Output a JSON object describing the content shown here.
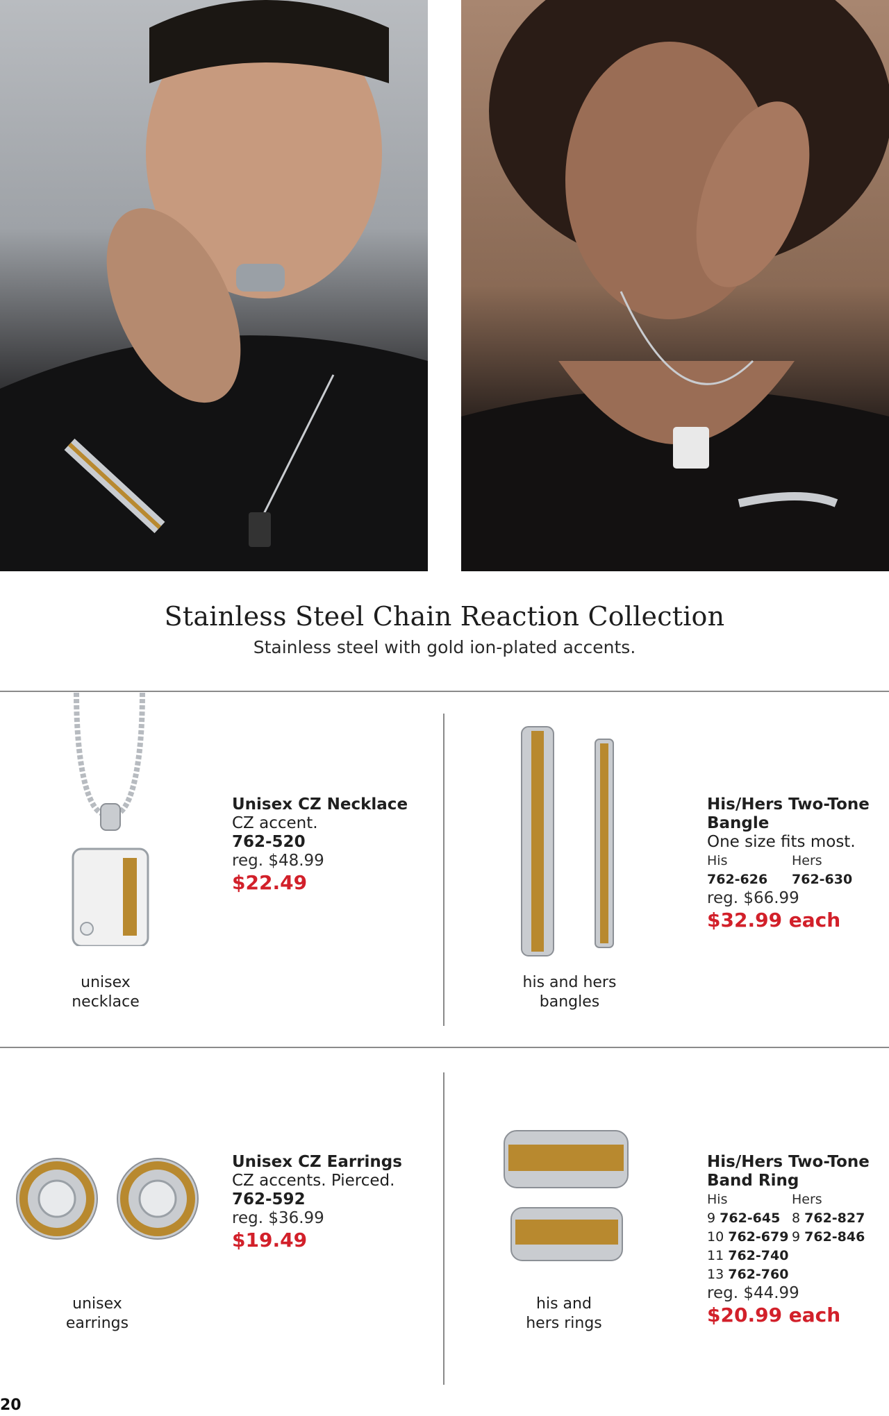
{
  "page": {
    "number": "20"
  },
  "header": {
    "title": "Stainless Steel Chain Reaction Collection",
    "subtitle": "Stainless steel with gold ion-plated accents."
  },
  "products": [
    {
      "caption_line1": "unisex",
      "caption_line2": "necklace",
      "name": "Unisex CZ Necklace",
      "desc": "CZ accent.",
      "item": "762-520",
      "reg": "reg. $48.99",
      "price": "$22.49"
    },
    {
      "caption_line1": "his and hers",
      "caption_line2": "bangles",
      "name_line1": "His/Hers Two-Tone",
      "name_line2": "Bangle",
      "desc": "One size fits most.",
      "his_label": "His",
      "hers_label": "Hers",
      "his_item": "762-626",
      "hers_item": "762-630",
      "reg": "reg. $66.99",
      "price": "$32.99 each"
    },
    {
      "caption_line1": "unisex",
      "caption_line2": "earrings",
      "name": "Unisex CZ Earrings",
      "desc": "CZ accents. Pierced.",
      "item": "762-592",
      "reg": "reg. $36.99",
      "price": "$19.49"
    },
    {
      "caption_line1": "his and",
      "caption_line2": "hers rings",
      "name_line1": "His/Hers Two-Tone",
      "name_line2": "Band Ring",
      "his_label": "His",
      "hers_label": "Hers",
      "his_sizes": [
        {
          "size": "9",
          "item": "762-645"
        },
        {
          "size": "10",
          "item": "762-679"
        },
        {
          "size": "11",
          "item": "762-740"
        },
        {
          "size": "13",
          "item": "762-760"
        }
      ],
      "hers_sizes": [
        {
          "size": "8",
          "item": "762-827"
        },
        {
          "size": "9",
          "item": "762-846"
        }
      ],
      "reg": "reg. $44.99",
      "price": "$20.99 each"
    }
  ],
  "colors": {
    "price_red": "#d2202a",
    "gold": "#b8892f",
    "steel": "#c9ccd0"
  }
}
